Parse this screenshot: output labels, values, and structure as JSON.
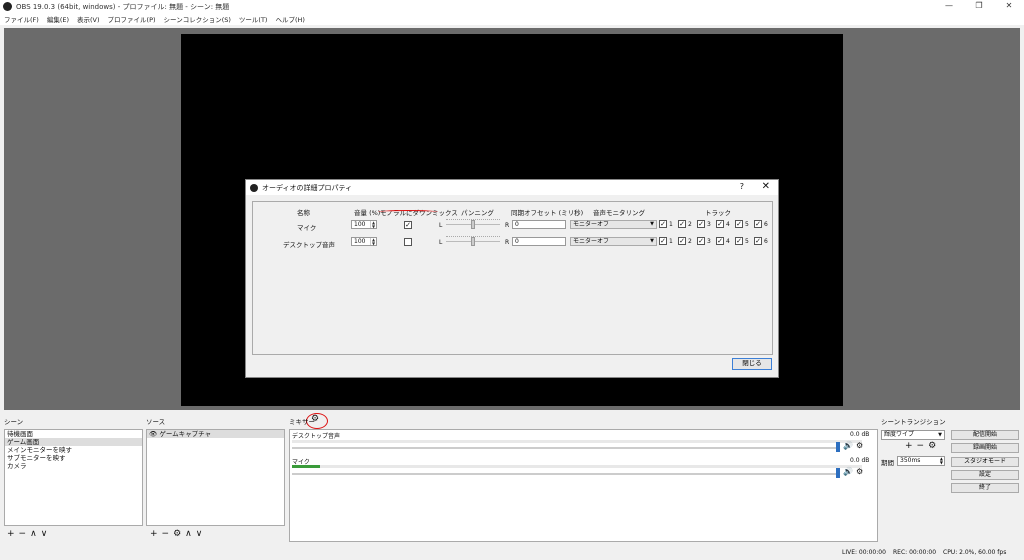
{
  "window": {
    "title": "OBS 19.0.3 (64bit, windows) - プロファイル: 無題 - シーン: 無題",
    "minimize": "—",
    "maximize": "❐",
    "close": "✕"
  },
  "menu": [
    "ファイル(F)",
    "編集(E)",
    "表示(V)",
    "プロファイル(P)",
    "シーンコレクション(S)",
    "ツール(T)",
    "ヘルプ(H)"
  ],
  "dialog": {
    "title": "オーディオの詳細プロパティ",
    "help": "?",
    "close": "✕",
    "headers": {
      "name": "名称",
      "volume": "音量 (%)",
      "downmix": "モノラルにダウンミックス",
      "panning": "パンニング",
      "sync_offset": "同期オフセット (ミリ秒)",
      "monitoring": "音声モニタリング",
      "tracks": "トラック"
    },
    "rows": [
      {
        "name": "マイク",
        "volume": "100",
        "downmix": "✓",
        "pan_l": "L",
        "pan_r": "R",
        "offset": "0",
        "monitoring": "モニターオフ",
        "tracks": [
          "1",
          "2",
          "3",
          "4",
          "5",
          "6"
        ]
      },
      {
        "name": "デスクトップ音声",
        "volume": "100",
        "downmix": "",
        "pan_l": "L",
        "pan_r": "R",
        "offset": "0",
        "monitoring": "モニターオフ",
        "tracks": [
          "1",
          "2",
          "3",
          "4",
          "5",
          "6"
        ]
      }
    ],
    "close_button": "閉じる"
  },
  "docks": {
    "scenes": {
      "title": "シーン",
      "items": [
        "待機画面",
        "ゲーム画面",
        "メインモニターを映す",
        "サブモニターを映す",
        "カメラ"
      ]
    },
    "sources": {
      "title": "ソース",
      "items": [
        "ゲームキャプチャ"
      ]
    },
    "mixer": {
      "title": "ミキサー",
      "channels": [
        {
          "name": "デスクトップ音声",
          "db": "0.0 dB"
        },
        {
          "name": "マイク",
          "db": "0.0 dB"
        }
      ]
    },
    "transitions": {
      "title": "シーントランジション",
      "selected": "輝度ワイプ",
      "duration_label": "期間",
      "duration": "350ms"
    },
    "controls": [
      "配信開始",
      "録画開始",
      "スタジオモード",
      "設定",
      "終了"
    ]
  },
  "status": {
    "live": "LIVE: 00:00:00",
    "rec": "REC: 00:00:00",
    "cpu": "CPU: 2.0%, 60.00 fps"
  }
}
